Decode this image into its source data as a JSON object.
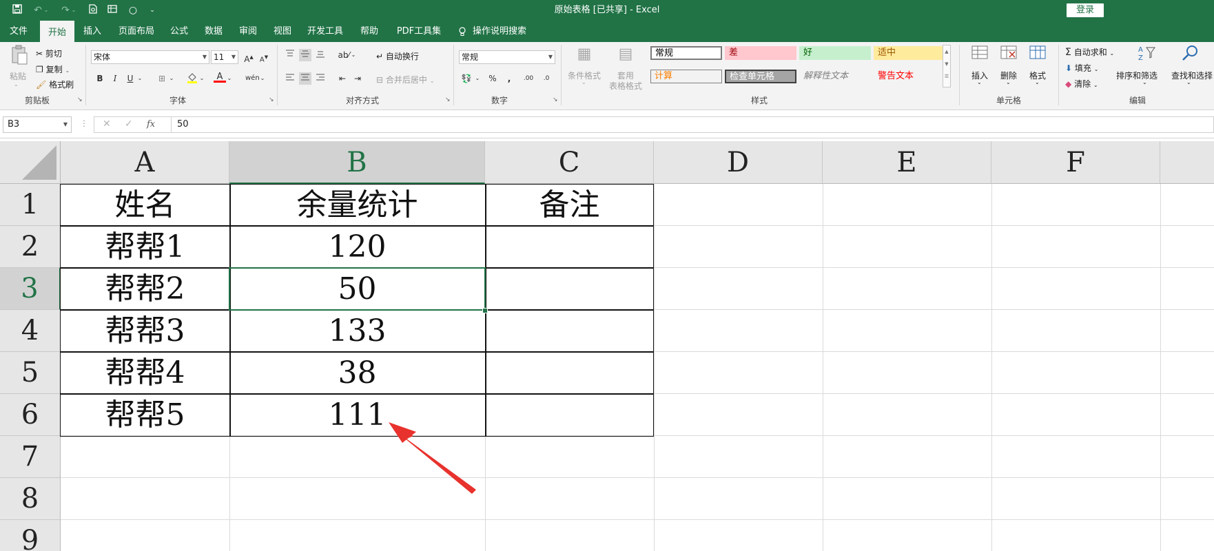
{
  "window": {
    "title": "原始表格 [已共享] - Excel",
    "login_label": "登录"
  },
  "quick_access": [
    "save-icon",
    "undo-icon",
    "redo-icon",
    "print-preview-icon",
    "form-icon",
    "circle-icon",
    "customize-icon"
  ],
  "tabs": [
    {
      "label": "文件"
    },
    {
      "label": "开始"
    },
    {
      "label": "插入"
    },
    {
      "label": "页面布局"
    },
    {
      "label": "公式"
    },
    {
      "label": "数据"
    },
    {
      "label": "审阅"
    },
    {
      "label": "视图"
    },
    {
      "label": "开发工具"
    },
    {
      "label": "帮助"
    },
    {
      "label": "PDF工具集"
    },
    {
      "label": "操作说明搜索"
    }
  ],
  "active_tab": "开始",
  "ribbon": {
    "clipboard": {
      "label": "剪贴板",
      "paste": "粘贴",
      "cut": "剪切",
      "copy": "复制",
      "format_painter": "格式刷"
    },
    "font": {
      "label": "字体",
      "font_name": "宋体",
      "font_size": "11"
    },
    "alignment": {
      "label": "对齐方式",
      "wrap": "自动换行",
      "merge": "合并后居中"
    },
    "number": {
      "label": "数字",
      "format": "常规"
    },
    "styles": {
      "label": "样式",
      "cond_format": "条件格式",
      "table_format_1": "套用",
      "table_format_2": "表格格式",
      "cells": [
        {
          "text": "常规",
          "bg": "#ffffff",
          "color": "#000000",
          "border": "#7a7a7a"
        },
        {
          "text": "差",
          "bg": "#ffc7ce",
          "color": "#9c0006",
          "border": "#ffc7ce"
        },
        {
          "text": "好",
          "bg": "#c6efce",
          "color": "#006100",
          "border": "#c6efce"
        },
        {
          "text": "适中",
          "bg": "#ffeb9c",
          "color": "#9c5700",
          "border": "#ffeb9c"
        },
        {
          "text": "计算",
          "bg": "#f2f2f2",
          "color": "#fa7d00",
          "border": "#7f7f7f"
        },
        {
          "text": "检查单元格",
          "bg": "#a5a5a5",
          "color": "#ffffff",
          "border": "#3f3f3f"
        },
        {
          "text": "解释性文本",
          "bg": "#f3f3f3",
          "color": "#7f7f7f",
          "border": "#f3f3f3"
        },
        {
          "text": "警告文本",
          "bg": "#f3f3f3",
          "color": "#ff0000",
          "border": "#f3f3f3"
        }
      ]
    },
    "cells_group": {
      "label": "单元格",
      "insert": "插入",
      "delete": "删除",
      "format": "格式"
    },
    "editing": {
      "label": "编辑",
      "autosum": "自动求和",
      "fill": "填充",
      "clear": "清除",
      "sort": "排序和筛选",
      "find": "查找和选择"
    }
  },
  "formula_bar": {
    "name_box": "B3",
    "value": "50"
  },
  "sheet": {
    "columns": [
      "A",
      "B",
      "C",
      "D",
      "E",
      "F"
    ],
    "selected_column": "B",
    "rows": [
      "1",
      "2",
      "3",
      "4",
      "5",
      "6",
      "7",
      "8",
      "9"
    ],
    "selected_row": "3",
    "cells": [
      [
        "姓名",
        "余量统计",
        "备注"
      ],
      [
        "帮帮1",
        "120",
        ""
      ],
      [
        "帮帮2",
        "50",
        ""
      ],
      [
        "帮帮3",
        "133",
        ""
      ],
      [
        "帮帮4",
        "38",
        ""
      ],
      [
        "帮帮5",
        "111",
        ""
      ]
    ],
    "active_cell": "B3",
    "annotation_color": "#e8322d"
  },
  "colors": {
    "excel_green": "#217346",
    "selection_green": "#217346"
  }
}
